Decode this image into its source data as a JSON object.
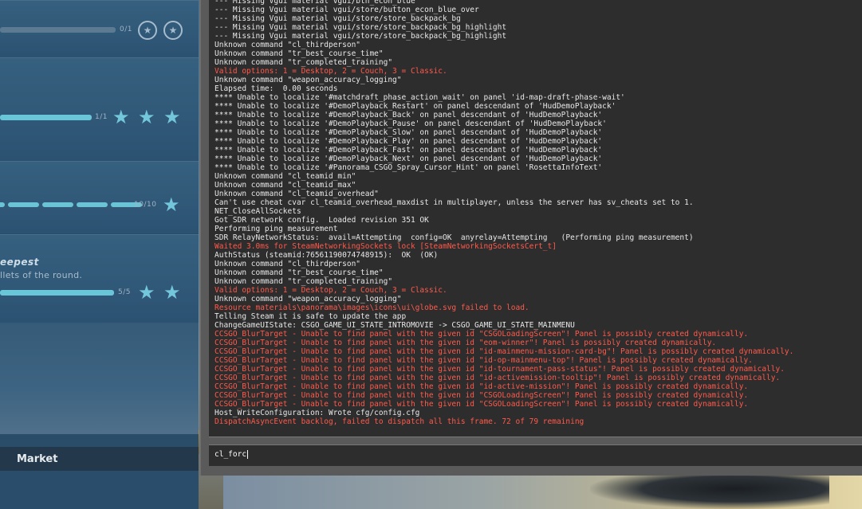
{
  "missions": {
    "rows": [
      {
        "progress": "0/1",
        "fill": 0.0,
        "stars": "outline"
      },
      {
        "progress": "1/1",
        "fill": 1.0,
        "stars": "filled"
      },
      {
        "progress": "10/10",
        "fill": 1.0,
        "stars": "filled"
      },
      {
        "progress": "5/5",
        "fill": 1.0,
        "stars": "filled"
      }
    ],
    "title_fragment": "eepest",
    "desc_fragment": "llets of the round.",
    "market_label": "Market"
  },
  "console": {
    "lines": [
      {
        "t": "--- Missing Vgui material vgui/btn_econ_blue",
        "err": false
      },
      {
        "t": "--- Missing Vgui material vgui/store/button_econ_blue_over",
        "err": false
      },
      {
        "t": "--- Missing Vgui material vgui/store/store_backpack_bg",
        "err": false
      },
      {
        "t": "--- Missing Vgui material vgui/store/store_backpack_bg_highlight",
        "err": false
      },
      {
        "t": "--- Missing Vgui material vgui/store/store_backpack_bg_highlight",
        "err": false
      },
      {
        "t": "Unknown command \"cl_thirdperson\"",
        "err": false
      },
      {
        "t": "Unknown command \"tr_best_course_time\"",
        "err": false
      },
      {
        "t": "Unknown command \"tr_completed_training\"",
        "err": false
      },
      {
        "t": "Valid options: 1 = Desktop, 2 = Couch, 3 = Classic.",
        "err": true
      },
      {
        "t": "Unknown command \"weapon_accuracy_logging\"",
        "err": false
      },
      {
        "t": "Elapsed time:  0.00 seconds",
        "err": false
      },
      {
        "t": "**** Unable to localize '#matchdraft_phase_action_wait' on panel 'id-map-draft-phase-wait'",
        "err": false
      },
      {
        "t": "**** Unable to localize '#DemoPlayback_Restart' on panel descendant of 'HudDemoPlayback'",
        "err": false
      },
      {
        "t": "**** Unable to localize '#DemoPlayback_Back' on panel descendant of 'HudDemoPlayback'",
        "err": false
      },
      {
        "t": "**** Unable to localize '#DemoPlayback_Pause' on panel descendant of 'HudDemoPlayback'",
        "err": false
      },
      {
        "t": "**** Unable to localize '#DemoPlayback_Slow' on panel descendant of 'HudDemoPlayback'",
        "err": false
      },
      {
        "t": "**** Unable to localize '#DemoPlayback_Play' on panel descendant of 'HudDemoPlayback'",
        "err": false
      },
      {
        "t": "**** Unable to localize '#DemoPlayback_Fast' on panel descendant of 'HudDemoPlayback'",
        "err": false
      },
      {
        "t": "**** Unable to localize '#DemoPlayback_Next' on panel descendant of 'HudDemoPlayback'",
        "err": false
      },
      {
        "t": "**** Unable to localize '#Panorama_CSGO_Spray_Cursor_Hint' on panel 'RosettaInfoText'",
        "err": false
      },
      {
        "t": "Unknown command \"cl_teamid_min\"",
        "err": false
      },
      {
        "t": "Unknown command \"cl_teamid_max\"",
        "err": false
      },
      {
        "t": "Unknown command \"cl_teamid_overhead\"",
        "err": false
      },
      {
        "t": "Can't use cheat cvar cl_teamid_overhead_maxdist in multiplayer, unless the server has sv_cheats set to 1.",
        "err": false
      },
      {
        "t": "NET_CloseAllSockets",
        "err": false
      },
      {
        "t": "Got SDR network config.  Loaded revision 351 OK",
        "err": false
      },
      {
        "t": "Performing ping measurement",
        "err": false
      },
      {
        "t": "SDR RelayNetworkStatus:  avail=Attempting  config=OK  anyrelay=Attempting   (Performing ping measurement)",
        "err": false
      },
      {
        "t": "Waited 3.0ms for SteamNetworkingSockets lock [SteamNetworkingSocketsCert_t]",
        "err": true
      },
      {
        "t": "AuthStatus (steamid:76561190074748915):  OK  (OK)",
        "err": false
      },
      {
        "t": "Unknown command \"cl_thirdperson\"",
        "err": false
      },
      {
        "t": "Unknown command \"tr_best_course_time\"",
        "err": false
      },
      {
        "t": "Unknown command \"tr_completed_training\"",
        "err": false
      },
      {
        "t": "Valid options: 1 = Desktop, 2 = Couch, 3 = Classic.",
        "err": true
      },
      {
        "t": "Unknown command \"weapon_accuracy_logging\"",
        "err": false
      },
      {
        "t": "Resource materials\\panorama\\images\\icons\\ui\\globe.svg failed to load.",
        "err": true
      },
      {
        "t": "Telling Steam it is safe to update the app",
        "err": false
      },
      {
        "t": "ChangeGameUIState: CSGO_GAME_UI_STATE_INTROMOVIE -> CSGO_GAME_UI_STATE_MAINMENU",
        "err": false
      },
      {
        "t": "CCSGO_BlurTarget - Unable to find panel with the given id \"CSGOLoadingScreen\"! Panel is possibly created dynamically.",
        "err": true
      },
      {
        "t": "CCSGO_BlurTarget - Unable to find panel with the given id \"eom-winner\"! Panel is possibly created dynamically.",
        "err": true
      },
      {
        "t": "CCSGO_BlurTarget - Unable to find panel with the given id \"id-mainmenu-mission-card-bg\"! Panel is possibly created dynamically.",
        "err": true
      },
      {
        "t": "CCSGO_BlurTarget - Unable to find panel with the given id \"id-op-mainmenu-top\"! Panel is possibly created dynamically.",
        "err": true
      },
      {
        "t": "CCSGO_BlurTarget - Unable to find panel with the given id \"id-tournament-pass-status\"! Panel is possibly created dynamically.",
        "err": true
      },
      {
        "t": "CCSGO_BlurTarget - Unable to find panel with the given id \"id-activemission-tooltip\"! Panel is possibly created dynamically.",
        "err": true
      },
      {
        "t": "CCSGO_BlurTarget - Unable to find panel with the given id \"id-active-mission\"! Panel is possibly created dynamically.",
        "err": true
      },
      {
        "t": "CCSGO_BlurTarget - Unable to find panel with the given id \"CSGOLoadingScreen\"! Panel is possibly created dynamically.",
        "err": true
      },
      {
        "t": "CCSGO_BlurTarget - Unable to find panel with the given id \"CSGOLoadingScreen\"! Panel is possibly created dynamically.",
        "err": true
      },
      {
        "t": "Host_WriteConfiguration: Wrote cfg/config.cfg",
        "err": false
      },
      {
        "t": "DispatchAsyncEvent backlog, failed to dispatch all this frame. 72 of 79 remaining",
        "err": true
      }
    ],
    "input_value": "cl_forc"
  }
}
